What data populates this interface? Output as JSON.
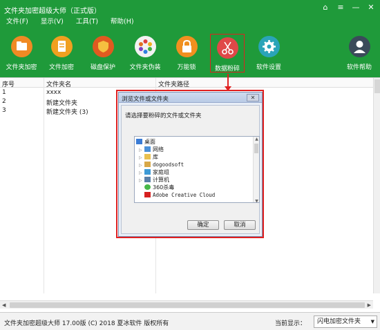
{
  "app": {
    "title": "文件夹加密超级大师（正式版）"
  },
  "menu": [
    "文件(F)",
    "显示(V)",
    "工具(T)",
    "帮助(H)"
  ],
  "toolbar": [
    {
      "label": "文件夹加密",
      "icon": "folder-icon"
    },
    {
      "label": "文件加密",
      "icon": "file-icon"
    },
    {
      "label": "磁盘保护",
      "icon": "shield-icon"
    },
    {
      "label": "文件夹伪装",
      "icon": "palette-icon"
    },
    {
      "label": "万能锁",
      "icon": "lock-icon"
    },
    {
      "label": "数据粉碎",
      "icon": "scissors-icon"
    },
    {
      "label": "软件设置",
      "icon": "gear-icon"
    },
    {
      "label": "软件帮助",
      "icon": "user-icon"
    }
  ],
  "table": {
    "headers": [
      "序号",
      "文件夹名",
      "文件夹路径"
    ],
    "rows": [
      {
        "no": "1",
        "name": "xxxx"
      },
      {
        "no": "2",
        "name": "新建文件夹"
      },
      {
        "no": "3",
        "name": "新建文件夹 (3)"
      }
    ]
  },
  "status": {
    "copyright": "文件夹加密超级大师 17.00版 (C) 2018 夏冰软件 版权所有",
    "current_label": "当前显示：",
    "current_value": "闪电加密文件夹"
  },
  "dialog": {
    "title": "浏览文件或文件夹",
    "prompt": "请选择要粉碎的文件或文件夹",
    "tree": [
      {
        "label": "桌面",
        "icon": "desktop-icon",
        "level": 0,
        "expandable": false
      },
      {
        "label": "网络",
        "icon": "network-icon",
        "level": 1,
        "expandable": true
      },
      {
        "label": "库",
        "icon": "library-icon",
        "level": 1,
        "expandable": true
      },
      {
        "label": "dogoodsoft",
        "icon": "user-folder-icon",
        "level": 1,
        "expandable": true
      },
      {
        "label": "家庭组",
        "icon": "homegroup-icon",
        "level": 1,
        "expandable": true
      },
      {
        "label": "计算机",
        "icon": "computer-icon",
        "level": 1,
        "expandable": true
      },
      {
        "label": "360杀毒",
        "icon": "antivirus-icon",
        "level": 1,
        "expandable": false
      },
      {
        "label": "Adobe Creative Cloud",
        "icon": "adobe-cc-icon",
        "level": 1,
        "expandable": false
      }
    ],
    "ok": "确定",
    "cancel": "取消"
  },
  "colors": {
    "brand_green": "#1f9a3a",
    "highlight_red": "#e02020"
  }
}
